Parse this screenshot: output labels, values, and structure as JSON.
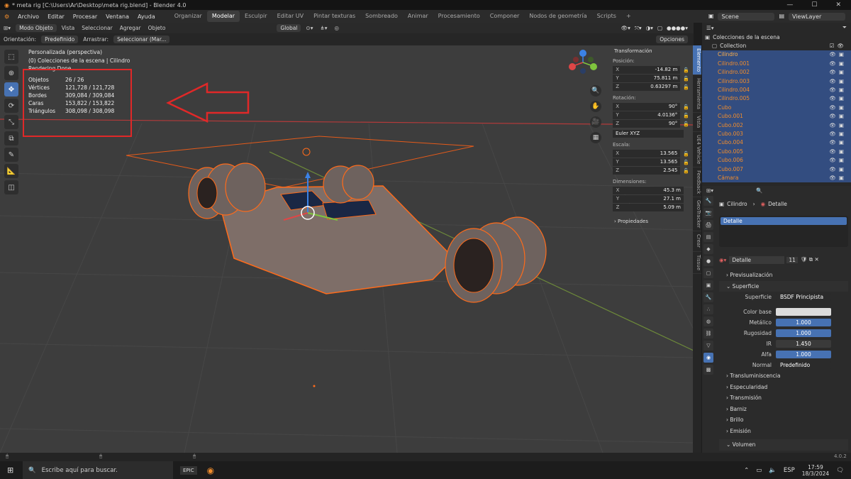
{
  "window": {
    "title": "* meta rig [C:\\Users\\Ar\\Desktop\\meta rig.blend] - Blender 4.0"
  },
  "menu": [
    "Archivo",
    "Editar",
    "Procesar",
    "Ventana",
    "Ayuda"
  ],
  "workspaces": [
    "Organizar",
    "Modelar",
    "Esculpir",
    "Editar UV",
    "Pintar texturas",
    "Sombreado",
    "Animar",
    "Procesamiento",
    "Componer",
    "Nodos de geometría",
    "Scripts"
  ],
  "active_workspace": "Modelar",
  "scene": "Scene",
  "viewlayer": "ViewLayer",
  "header": {
    "mode": "Modo Objeto",
    "vista": "Vista",
    "seleccionar": "Seleccionar",
    "agregar": "Agregar",
    "objeto": "Objeto",
    "transform": "Global"
  },
  "header2": {
    "orient_label": "Orientación:",
    "orient_value": "Predefinido",
    "drag_label": "Arrastrar:",
    "drag_value": "Seleccionar (Mar...",
    "options": "Opciones"
  },
  "viewport": {
    "line1": "Personalizada (perspectiva)",
    "line2": "(0) Colecciones de la escena | Cilindro",
    "line3": "Rendering Done"
  },
  "stats": [
    {
      "k": "Objetos",
      "v": "26 / 26"
    },
    {
      "k": "Vértices",
      "v": "121,728 / 121,728"
    },
    {
      "k": "Bordes",
      "v": "309,084 / 309,084"
    },
    {
      "k": "Caras",
      "v": "153,822 / 153,822"
    },
    {
      "k": "Triángulos",
      "v": "308,098 / 308,098"
    }
  ],
  "npanel": {
    "title": "Transformación",
    "pos_label": "Posición:",
    "pos": {
      "x": "-14.82 m",
      "y": "75.811 m",
      "z": "0.63297 m"
    },
    "rot_label": "Rotación:",
    "rot": {
      "x": "90°",
      "y": "4.0136°",
      "z": "90°"
    },
    "rot_mode": "Euler XYZ",
    "scale_label": "Escala:",
    "scale": {
      "x": "13.565",
      "y": "13.565",
      "z": "2.545"
    },
    "dim_label": "Dimensiones:",
    "dim": {
      "x": "45.3 m",
      "y": "27.1 m",
      "z": "5.09 m"
    },
    "props": "Propiedades"
  },
  "sidetabs": [
    "Elemento",
    "Herramienta",
    "Vista",
    "UE4 Vehicle",
    "Feedback",
    "GeoTracker",
    "Crear",
    "Tissue"
  ],
  "outliner": {
    "root": "Colecciones de la escena",
    "collection": "Collection",
    "items": [
      "Cilindro",
      "Cilindro.001",
      "Cilindro.002",
      "Cilindro.003",
      "Cilindro.004",
      "Cilindro.005",
      "Cubo",
      "Cubo.001",
      "Cubo.002",
      "Cubo.003",
      "Cubo.004",
      "Cubo.005",
      "Cubo.006",
      "Cubo.007",
      "Cámara"
    ]
  },
  "props": {
    "object": "Cilindro",
    "material": "Detalle",
    "slot": "Detalle",
    "matname": "Detalle",
    "users": "11",
    "preview": "Previsualización",
    "surface": "Superficie",
    "surface_label": "Superficie",
    "surface_value": "BSDF Principista",
    "rows": [
      {
        "k": "Color base",
        "v": ""
      },
      {
        "k": "Metálico",
        "v": "1.000"
      },
      {
        "k": "Rugosidad",
        "v": "1.000"
      },
      {
        "k": "IR",
        "v": "1.450"
      },
      {
        "k": "Alfa",
        "v": "1.000"
      }
    ],
    "normal_label": "Normal",
    "normal_value": "Predefinido",
    "sections": [
      "Transluminiscencia",
      "Especularidad",
      "Transmisión",
      "Barniz",
      "Brillo",
      "Emisión"
    ],
    "volume": "Volumen"
  },
  "version": "4.0.2",
  "taskbar": {
    "search": "Escribe aquí para buscar.",
    "lang": "ESP",
    "time": "17:59",
    "date": "18/3/2024"
  }
}
